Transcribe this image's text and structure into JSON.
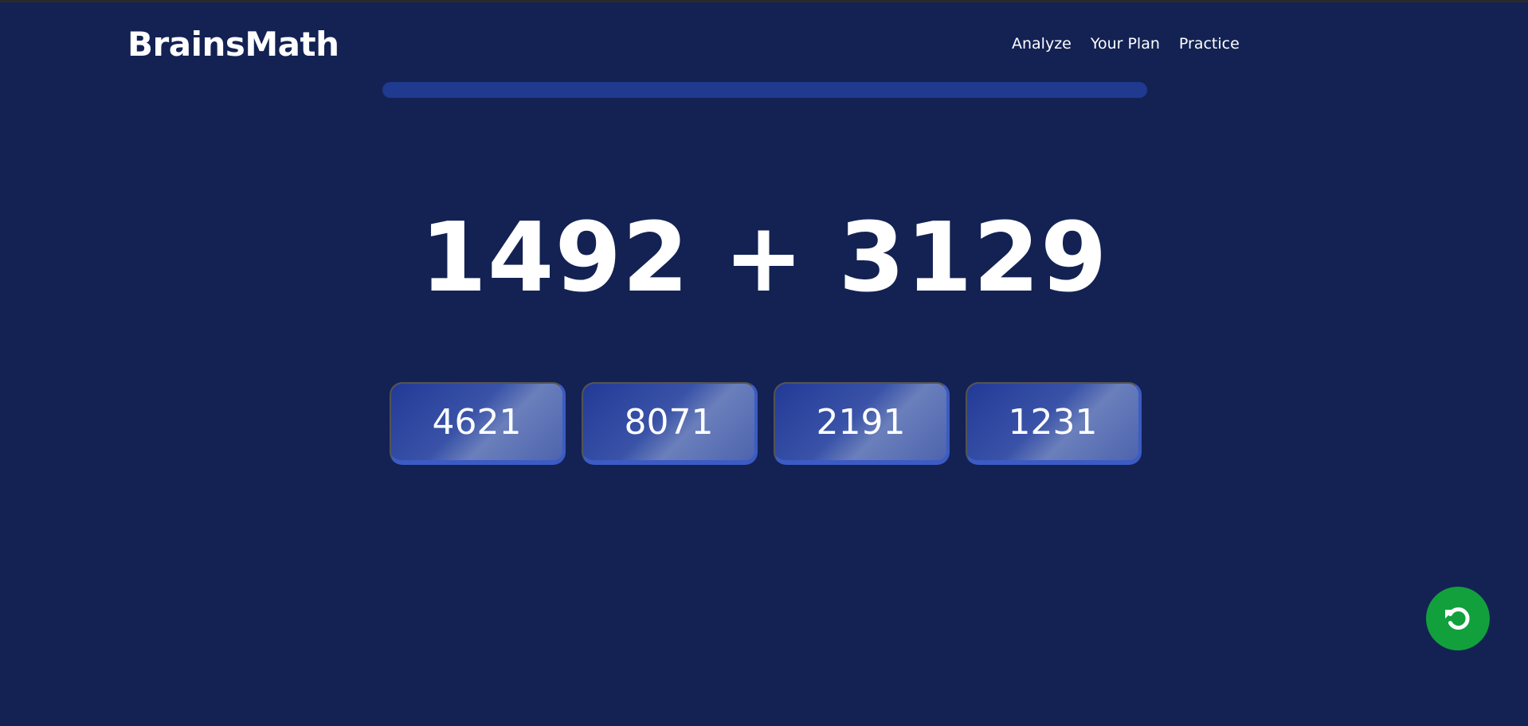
{
  "app": {
    "brand": "BrainsMath"
  },
  "nav": {
    "items": [
      {
        "label": "Analyze"
      },
      {
        "label": "Your Plan"
      },
      {
        "label": "Practice"
      }
    ]
  },
  "progress": {
    "value": 0
  },
  "problem": {
    "text": "1492 + 3129"
  },
  "answers": [
    {
      "label": "4621"
    },
    {
      "label": "8071"
    },
    {
      "label": "2191"
    },
    {
      "label": "1231"
    }
  ],
  "reset_button": {
    "icon": "refresh-icon",
    "color": "#12a03c"
  },
  "colors": {
    "background": "#132253",
    "progress_track": "#1f3a8e",
    "answer_accent": "#3c5bc4"
  }
}
